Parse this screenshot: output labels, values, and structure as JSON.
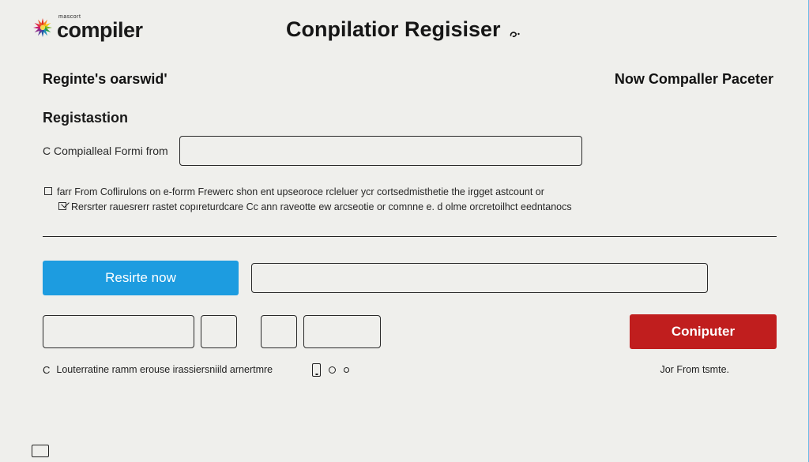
{
  "brand": {
    "kicker": "mascort",
    "name": "compiler"
  },
  "page_title": "Conpilatior Regisiser",
  "subheader": {
    "left": "Reginte's oarswid'",
    "right": "Now Compaller Paceter"
  },
  "section": {
    "title": "Registastion",
    "first_field_label": "C Compialleal Formi from"
  },
  "info": {
    "line1": "farr From Coflirulons on e-forrm Frewerc shon ent upseoroce rcleluer ycr cortsedmisthetie the irgget astcount or",
    "line2": "Rersrter rauesrerr rastet copıreturdcare Cc ann raveotte ew arcseotie or comnne e. d olme orcretoilhct eedntanocs"
  },
  "actions": {
    "register_now": "Resirte now",
    "compiler": "Coniputer"
  },
  "footer": {
    "left_text": "Louterratine ramm erouse irassiersniild arnertmre",
    "right_text": "Jor From tsmte."
  },
  "colors": {
    "primary": "#1d9ce0",
    "danger": "#c01e1e"
  }
}
